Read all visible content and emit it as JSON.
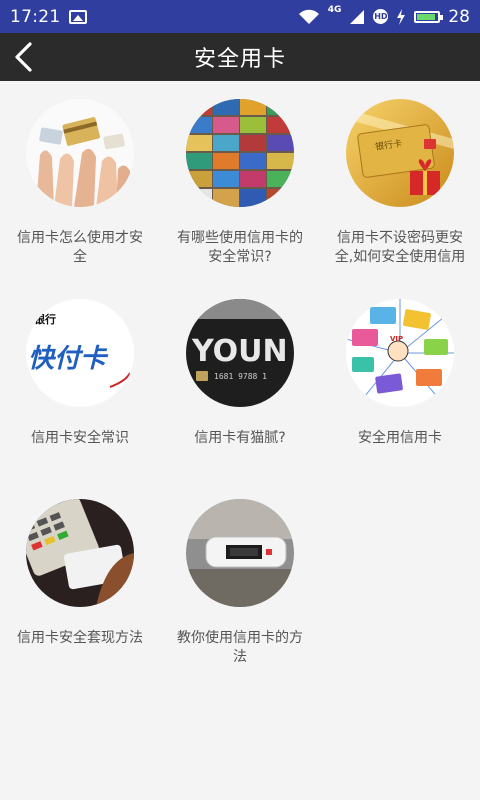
{
  "status_bar": {
    "time": "17:21",
    "network": "4G",
    "hd_badge": "HD",
    "battery_level": 0.9,
    "battery_text": "28"
  },
  "header": {
    "title": "安全用卡",
    "back_icon": "chevron-left-icon"
  },
  "items": [
    {
      "label": "信用卡怎么使用才安全"
    },
    {
      "label": "有哪些使用信用卡的安全常识?"
    },
    {
      "label": "信用卡不设密码更安全,如何安全使用信用卡"
    },
    {
      "label": "信用卡安全常识"
    },
    {
      "label": "信用卡有猫腻?"
    },
    {
      "label": "安全用信用卡"
    },
    {
      "label": "信用卡安全套现方法"
    },
    {
      "label": "教你使用信用卡的方法"
    }
  ],
  "thumb_text": {
    "bank": "银行卡",
    "bank_short": "银行",
    "fast_pay": "快付卡",
    "youn": "YOUN",
    "card_number": "1681 9788 1",
    "vip": "VIP"
  },
  "colors": {
    "status_bar": "#303f9f",
    "title_bar": "#2b2b2b",
    "background": "#f4f4f4",
    "label_text": "#555555"
  }
}
